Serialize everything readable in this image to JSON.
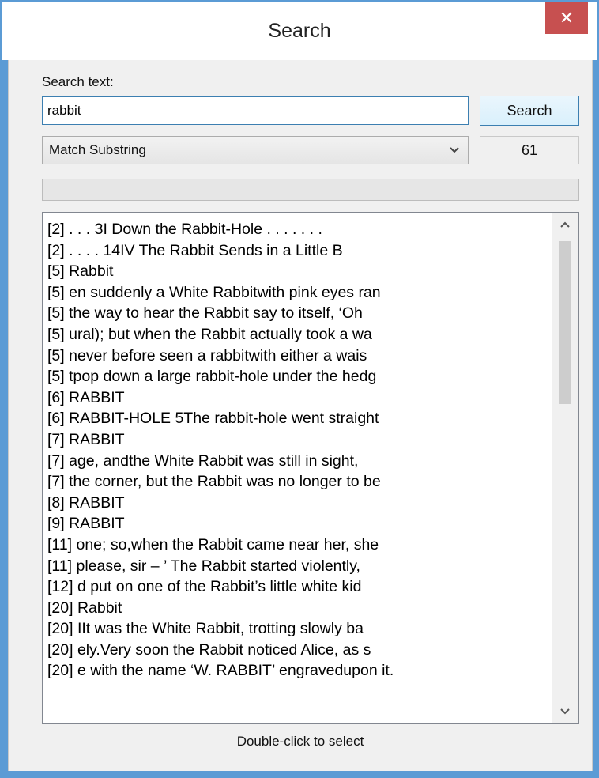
{
  "window": {
    "title": "Search",
    "close_glyph": "✕"
  },
  "form": {
    "search_label": "Search text:",
    "search_value": "rabbit",
    "search_button": "Search",
    "match_mode": "Match Substring",
    "match_mode_chevron": "chevron-down-icon",
    "result_count": "61",
    "progress_fraction": 0
  },
  "results": [
    "[2] . . . 3I Down the Rabbit-Hole . . . . . . .",
    "[2]  . . . . 14IV The Rabbit Sends in a Little B",
    "[5] Rabbit",
    "[5] en suddenly a White Rabbitwith pink eyes ran",
    "[5] the way to hear the Rabbit say to itself, ‘Oh",
    "[5] ural); but when the Rabbit actually took a wa",
    "[5] never before seen a rabbitwith either a wais",
    "[5] tpop down a large rabbit-hole under the hedg",
    "[6] RABBIT",
    "[6]  RABBIT-HOLE 5The rabbit-hole went straight",
    "[7] RABBIT",
    "[7] age, andthe White Rabbit was still in sight,",
    "[7] the corner, but the Rabbit was no longer to be",
    "[8] RABBIT",
    "[9] RABBIT",
    "[11]  one; so,when the Rabbit came near her, she",
    "[11] please, sir – ’ The Rabbit started violently,",
    "[12] d put on one of the Rabbit’s little white kid",
    "[20] Rabbit",
    "[20] IIt was the White Rabbit, trotting slowly ba",
    "[20] ely.Very soon the Rabbit noticed Alice, as s",
    "[20] e with the name ‘W. RABBIT’ engravedupon it."
  ],
  "scrollbar": {
    "up_glyph": "⌃",
    "down_glyph": "⌄"
  },
  "footer": {
    "hint": "Double-click to select"
  }
}
